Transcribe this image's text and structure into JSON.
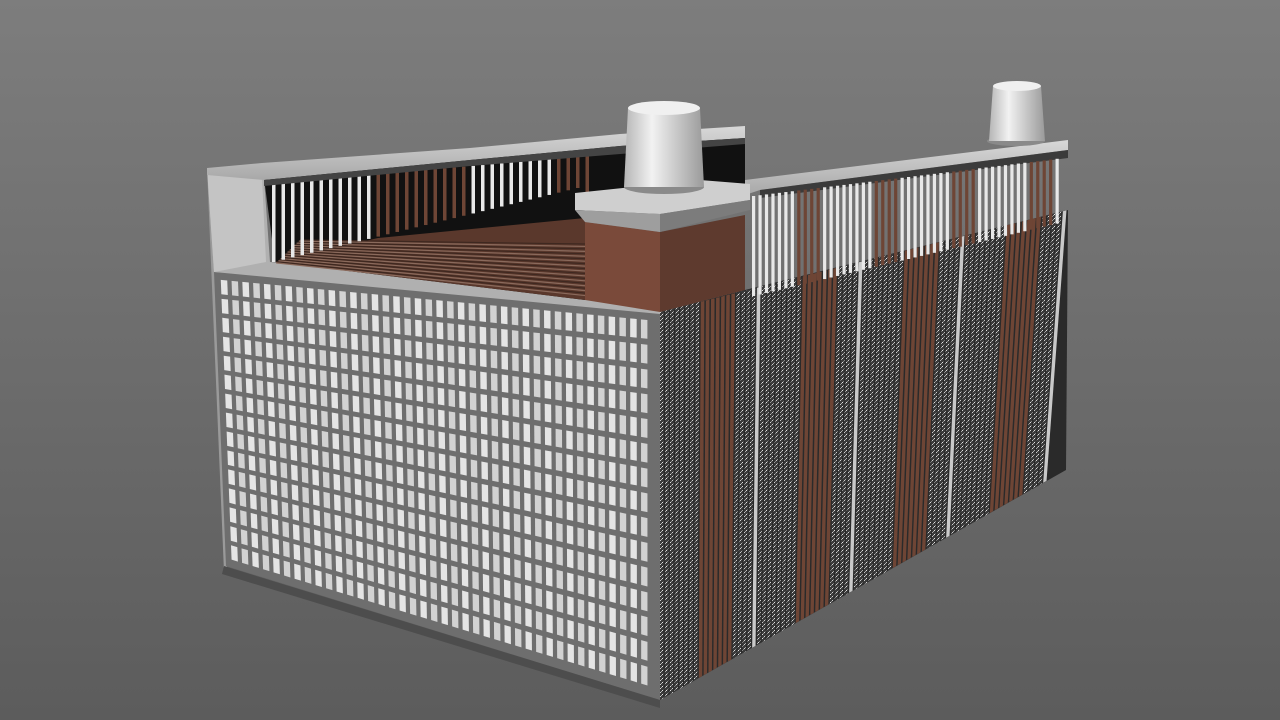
{
  "scene": {
    "subject": "lead-acid-battery-cutaway-render",
    "colors": {
      "background_top": "#7d7d7d",
      "background_bottom": "#5c5c5c",
      "case_light": "#c9c9c9",
      "case_mid": "#a6a6a6",
      "case_dark": "#8a8a8a",
      "grid_bar": "#e4e4e4",
      "grid_gap": "#6e6e6e",
      "plate_brown": "#6e4535",
      "plate_brown_dark": "#4a2c22",
      "plate_white": "#e8e8e8",
      "cavity_black": "#111111",
      "terminal_light": "#e6e6e6",
      "terminal_dark": "#9c9c9c"
    },
    "parts": {
      "terminals": [
        "positive-terminal",
        "negative-terminal"
      ],
      "cell_count_visible": 4
    }
  }
}
